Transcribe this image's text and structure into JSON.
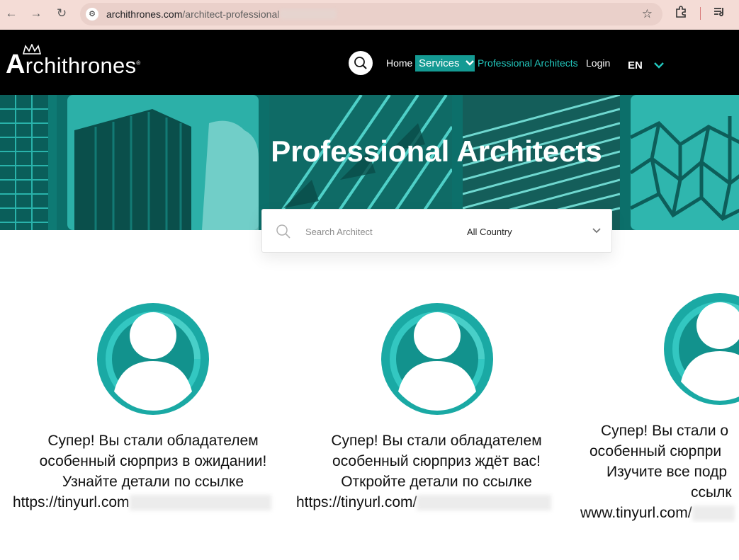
{
  "browser": {
    "url_domain": "archithrones.com",
    "url_path": "/architect-professional"
  },
  "header": {
    "logo_text": "rchithrones",
    "logo_initial": "A",
    "nav": {
      "home": "Home",
      "services": "Services",
      "professional_architects": "Professional Architects",
      "login": "Login"
    },
    "language": "EN"
  },
  "hero": {
    "title": "Professional Architects"
  },
  "search": {
    "placeholder": "Search Architect",
    "country_selected": "All Country"
  },
  "cards": [
    {
      "line1": "Супер! Вы стали обладателем",
      "line2": "особенный сюрприз в ожидании!",
      "line3": "Узнайте детали по ссылке",
      "link_prefix": "https://tinyurl.com"
    },
    {
      "line1": "Супер! Вы стали обладателем",
      "line2": "особенный сюрприз ждёт вас!",
      "line3": "Откройте детали по ссылке",
      "link_prefix": "https://tinyurl.com/"
    },
    {
      "line1": "Супер! Вы стали о",
      "line2": "особенный сюрпри",
      "line3": "Изучите все подр",
      "line4": "ссылк",
      "link_prefix": "www.tinyurl.com/"
    }
  ],
  "colors": {
    "accent": "#149a93",
    "header_bg": "#000000",
    "chrome_bg": "#f4dcd6",
    "avatar_teal": "#1aa9a4"
  }
}
